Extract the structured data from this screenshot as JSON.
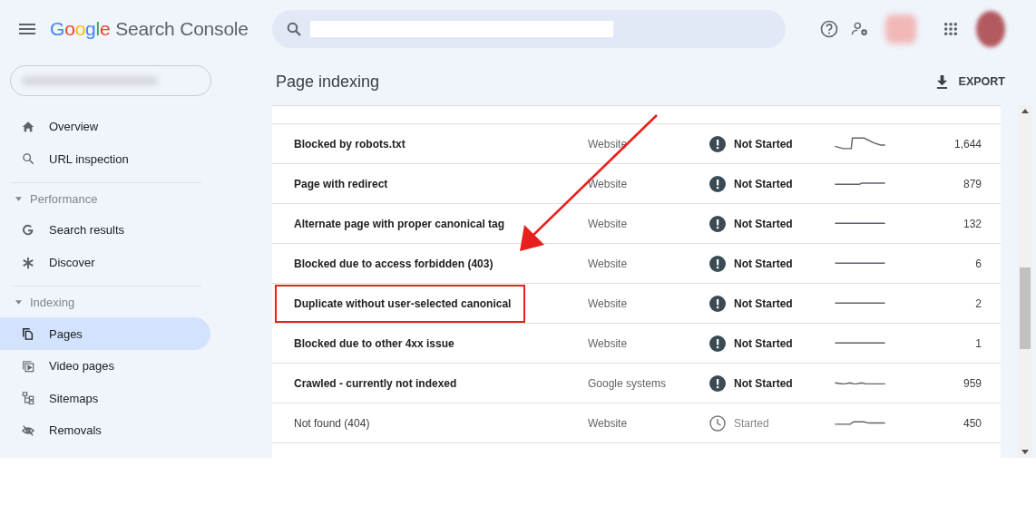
{
  "header": {
    "logo": {
      "brand": "Google",
      "product": "Search Console"
    }
  },
  "sidebar": {
    "groups": [
      {
        "items": [
          {
            "label": "Overview",
            "selected": false
          },
          {
            "label": "URL inspection",
            "selected": false
          }
        ]
      },
      {
        "heading": "Performance",
        "expanded": true,
        "items": [
          {
            "label": "Search results",
            "selected": false
          },
          {
            "label": "Discover",
            "selected": false
          }
        ]
      },
      {
        "heading": "Indexing",
        "expanded": true,
        "items": [
          {
            "label": "Pages",
            "selected": true
          },
          {
            "label": "Video pages",
            "selected": false
          },
          {
            "label": "Sitemaps",
            "selected": false
          },
          {
            "label": "Removals",
            "selected": false
          }
        ]
      }
    ]
  },
  "content": {
    "title": "Page indexing",
    "export": "EXPORT",
    "rows": [
      {
        "reason": "Blocked by robots.txt",
        "source": "Website",
        "status": "Not Started",
        "kind": "alert",
        "count": "1,644",
        "highlighted": false
      },
      {
        "reason": "Page with redirect",
        "source": "Website",
        "status": "Not Started",
        "kind": "alert",
        "count": "879",
        "highlighted": false
      },
      {
        "reason": "Alternate page with proper canonical tag",
        "source": "Website",
        "status": "Not Started",
        "kind": "alert",
        "count": "132",
        "highlighted": false
      },
      {
        "reason": "Blocked due to access forbidden (403)",
        "source": "Website",
        "status": "Not Started",
        "kind": "alert",
        "count": "6",
        "highlighted": false
      },
      {
        "reason": "Duplicate without user-selected canonical",
        "source": "Website",
        "status": "Not Started",
        "kind": "alert",
        "count": "2",
        "highlighted": true
      },
      {
        "reason": "Blocked due to other 4xx issue",
        "source": "Website",
        "status": "Not Started",
        "kind": "alert",
        "count": "1",
        "highlighted": false
      },
      {
        "reason": "Crawled - currently not indexed",
        "source": "Google systems",
        "status": "Not Started",
        "kind": "alert",
        "count": "959",
        "highlighted": false
      },
      {
        "reason": "Not found (404)",
        "source": "Website",
        "status": "Started",
        "kind": "clock",
        "count": "450",
        "highlighted": false
      }
    ]
  }
}
